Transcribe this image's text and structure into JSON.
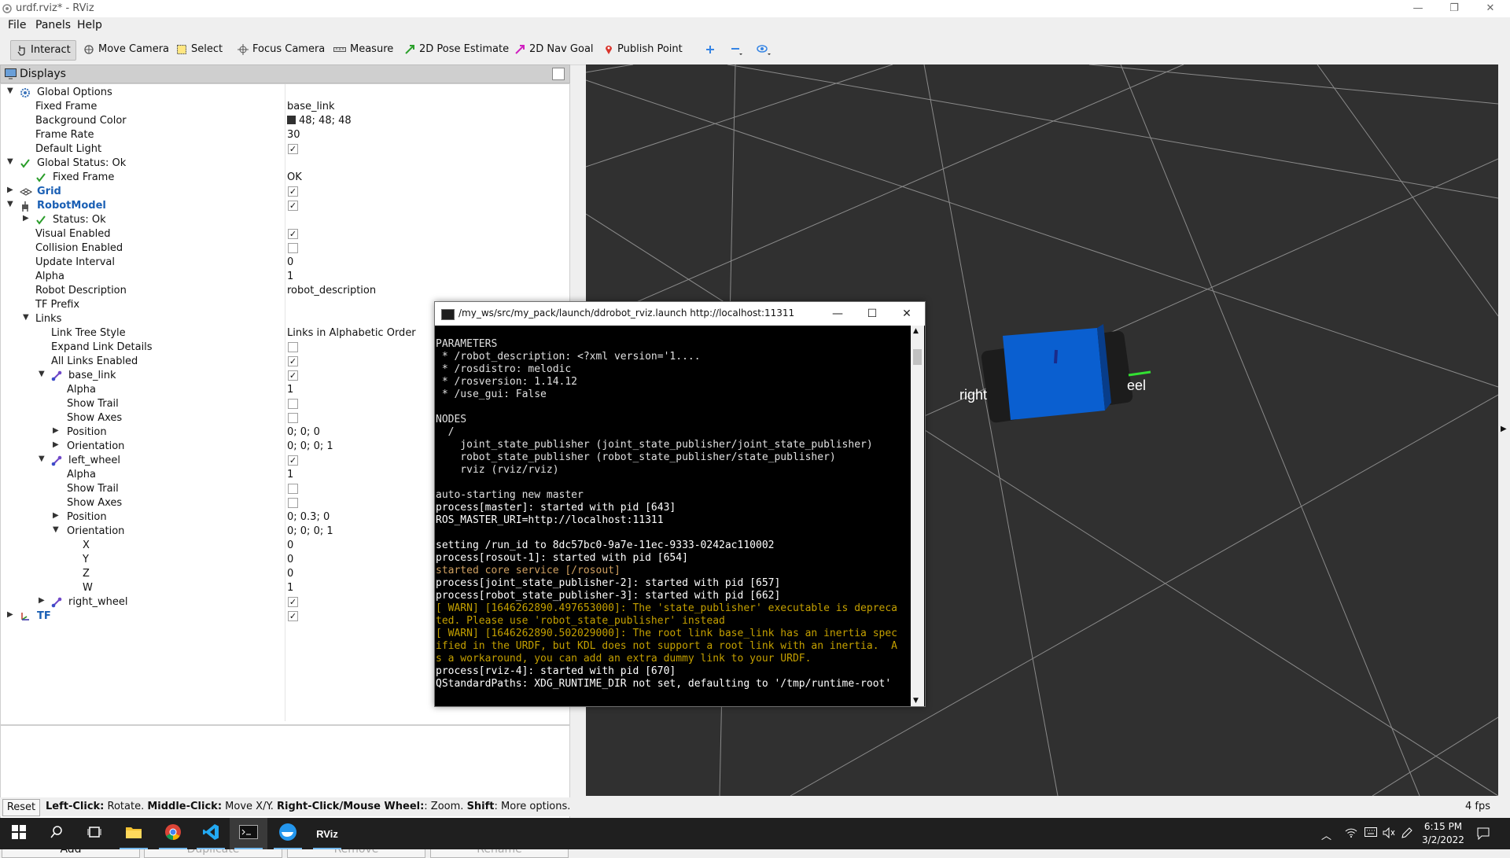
{
  "window": {
    "title": "urdf.rviz* - RViz",
    "minimize": "—",
    "maximize": "❐",
    "close": "✕"
  },
  "menu": [
    "File",
    "Panels",
    "Help"
  ],
  "toolbar": {
    "interact": "Interact",
    "move_camera": "Move Camera",
    "select": "Select",
    "focus_camera": "Focus Camera",
    "measure": "Measure",
    "pose_estimate": "2D Pose Estimate",
    "nav_goal": "2D Nav Goal",
    "publish_point": "Publish Point"
  },
  "displays": {
    "title": "Displays",
    "rows": [
      {
        "name": "Global Options",
        "value": ""
      },
      {
        "name": "Fixed Frame",
        "value": "base_link"
      },
      {
        "name": "Background Color",
        "value": "48; 48; 48"
      },
      {
        "name": "Frame Rate",
        "value": "30"
      },
      {
        "name": "Default Light",
        "value": ""
      },
      {
        "name": "Global Status: Ok",
        "value": ""
      },
      {
        "name": "Fixed Frame",
        "value": "OK"
      },
      {
        "name": "Grid",
        "value": ""
      },
      {
        "name": "RobotModel",
        "value": ""
      },
      {
        "name": "Status: Ok",
        "value": ""
      },
      {
        "name": "Visual Enabled",
        "value": ""
      },
      {
        "name": "Collision Enabled",
        "value": ""
      },
      {
        "name": "Update Interval",
        "value": "0"
      },
      {
        "name": "Alpha",
        "value": "1"
      },
      {
        "name": "Robot Description",
        "value": "robot_description"
      },
      {
        "name": "TF Prefix",
        "value": ""
      },
      {
        "name": "Links",
        "value": ""
      },
      {
        "name": "Link Tree Style",
        "value": "Links in Alphabetic Order"
      },
      {
        "name": "Expand Link Details",
        "value": ""
      },
      {
        "name": "All Links Enabled",
        "value": ""
      },
      {
        "name": "base_link",
        "value": ""
      },
      {
        "name": "Alpha",
        "value": "1"
      },
      {
        "name": "Show Trail",
        "value": ""
      },
      {
        "name": "Show Axes",
        "value": ""
      },
      {
        "name": "Position",
        "value": "0; 0; 0"
      },
      {
        "name": "Orientation",
        "value": "0; 0; 0; 1"
      },
      {
        "name": "left_wheel",
        "value": ""
      },
      {
        "name": "Alpha",
        "value": "1"
      },
      {
        "name": "Show Trail",
        "value": ""
      },
      {
        "name": "Show Axes",
        "value": ""
      },
      {
        "name": "Position",
        "value": "0; 0.3; 0"
      },
      {
        "name": "Orientation",
        "value": "0; 0; 0; 1"
      },
      {
        "name": "X",
        "value": "0"
      },
      {
        "name": "Y",
        "value": "0"
      },
      {
        "name": "Z",
        "value": "0"
      },
      {
        "name": "W",
        "value": "1"
      },
      {
        "name": "right_wheel",
        "value": ""
      },
      {
        "name": "TF",
        "value": ""
      }
    ],
    "buttons": {
      "add": "Add",
      "duplicate": "Duplicate",
      "remove": "Remove",
      "rename": "Rename"
    }
  },
  "scene": {
    "label_right": "right",
    "label_wheel": "eel"
  },
  "status": {
    "reset": "Reset",
    "hint_lc": "Left-Click:",
    "hint_lc_t": " Rotate. ",
    "hint_mc": "Middle-Click:",
    "hint_mc_t": " Move X/Y. ",
    "hint_rc": "Right-Click/Mouse Wheel:",
    "hint_rc_t": ": Zoom. ",
    "hint_sh": "Shift",
    "hint_sh_t": ": More options.",
    "fps": "4 fps"
  },
  "terminal": {
    "title": "/my_ws/src/my_pack/launch/ddrobot_rviz.launch http://localhost:11311",
    "lines": [
      "",
      "PARAMETERS",
      " * /robot_description: <?xml version='1....",
      " * /rosdistro: melodic",
      " * /rosversion: 1.14.12",
      " * /use_gui: False",
      "",
      "NODES",
      "  /",
      "    joint_state_publisher (joint_state_publisher/joint_state_publisher)",
      "    robot_state_publisher (robot_state_publisher/state_publisher)",
      "    rviz (rviz/rviz)",
      "",
      "auto-starting new master",
      "process[master]: started with pid [643]",
      "ROS_MASTER_URI=http://localhost:11311",
      "",
      "setting /run_id to 8dc57bc0-9a7e-11ec-9333-0242ac110002",
      "process[rosout-1]: started with pid [654]",
      "started core service [/rosout]",
      "process[joint_state_publisher-2]: started with pid [657]",
      "process[robot_state_publisher-3]: started with pid [662]",
      "[ WARN] [1646262890.497653000]: The 'state_publisher' executable is depreca",
      "ted. Please use 'robot_state_publisher' instead",
      "[ WARN] [1646262890.502029000]: The root link base_link has an inertia spec",
      "ified in the URDF, but KDL does not support a root link with an inertia.  A",
      "s a workaround, you can add an extra dummy link to your URDF.",
      "process[rviz-4]: started with pid [670]",
      "QStandardPaths: XDG_RUNTIME_DIR not set, defaulting to '/tmp/runtime-root'"
    ]
  },
  "taskbar": {
    "time": "6:15 PM",
    "date": "3/2/2022",
    "rviz_label": "RViz"
  }
}
